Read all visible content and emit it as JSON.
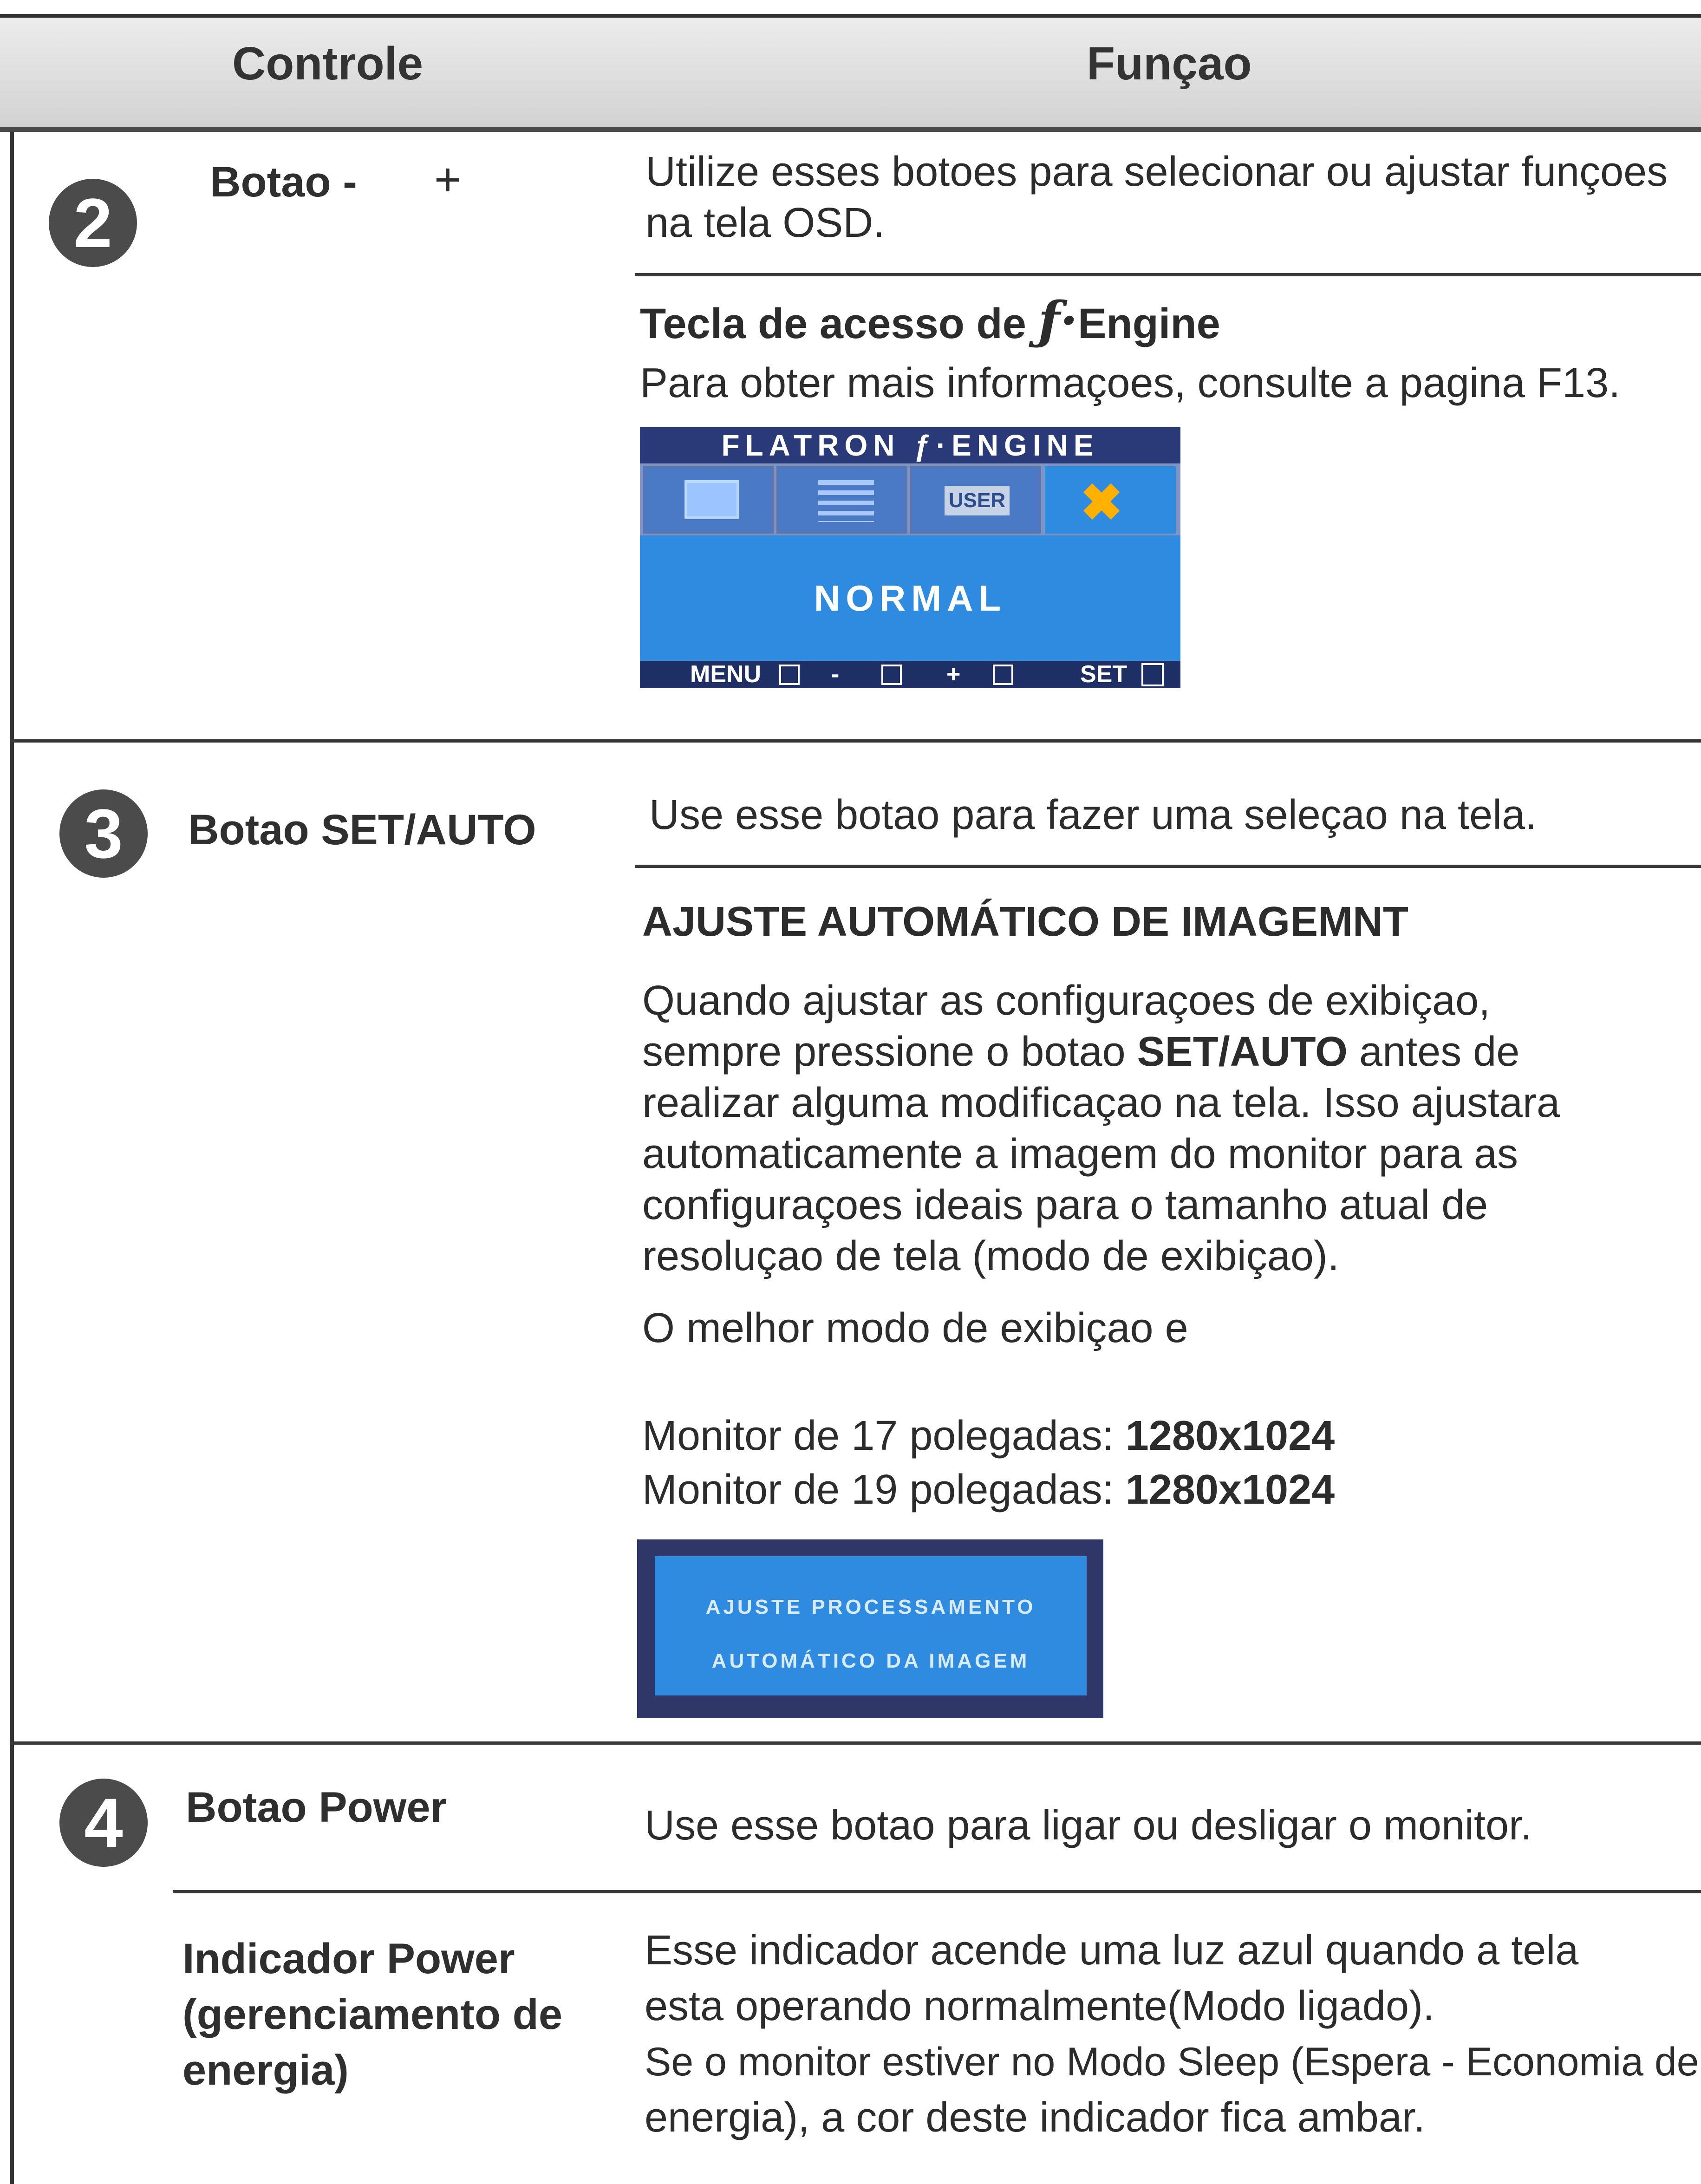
{
  "header": {
    "col1": "Controle",
    "col2": "Funçao"
  },
  "rows": [
    {
      "num": "2",
      "label_main": "Botao -",
      "label_plus": "+",
      "text1": "Utilize esses botoes para selecionar ou ajustar funçoes na tela OSD.",
      "fengine_title_prefix": "Tecla de acesso de",
      "fengine_title_suffix": "Engine",
      "fengine_text": "Para obter mais informaçoes, consulte a pagina F13.",
      "osd": {
        "title": "FLATRON  ƒ·ENGINE",
        "tab_user": "USER",
        "mode": "NORMAL",
        "footer": [
          "MENU",
          "-",
          "+",
          "SET"
        ]
      }
    },
    {
      "num": "3",
      "label": "Botao SET/AUTO",
      "text1": "Use esse botao para fazer uma seleçao na tela.",
      "heading": "AJUSTE AUTOMÁTICO DE IMAGEMNT",
      "para_1": "Quando ajustar as configuraçoes de exibiçao,",
      "para_2_pre": "sempre pressione o botao ",
      "para_2_bold": "SET/AUTO",
      "para_2_post": " antes de",
      "para_3": "realizar alguma modificaçao na tela. Isso ajustara",
      "para_4": "automaticamente a imagem do monitor para as",
      "para_5": "configuraçoes ideais para o tamanho atual de",
      "para_6": "resoluçao de tela (modo de exibiçao).",
      "best_mode": "O melhor modo de exibiçao e",
      "m17_label": "Monitor de 17 polegadas: ",
      "m17_value": "1280x1024",
      "m19_label": "Monitor de 19 polegadas: ",
      "m19_value": "1280x1024",
      "osd_line1": "AJUSTE PROCESSAMENTO",
      "osd_line2": "AUTOMÁTICO DA IMAGEM"
    },
    {
      "num": "4",
      "label": "Botao Power",
      "text": "Use esse botao para ligar ou desligar o monitor.",
      "indicator_label_1": "Indicador Power",
      "indicator_label_2": "(gerenciamento de",
      "indicator_label_3": "energia)",
      "indicator_text_1": "Esse indicador acende uma luz azul quando a tela",
      "indicator_text_2": "esta operando normalmente(Modo ligado).",
      "indicator_text_3": "Se o monitor estiver no Modo Sleep (Espera - Economia de",
      "indicator_text_4": "energia), a cor deste indicador fica ambar."
    }
  ],
  "colors": {
    "osd_blue": "#2f8be0",
    "osd_dark": "#1e2f66",
    "circle": "#4b4b4b"
  }
}
